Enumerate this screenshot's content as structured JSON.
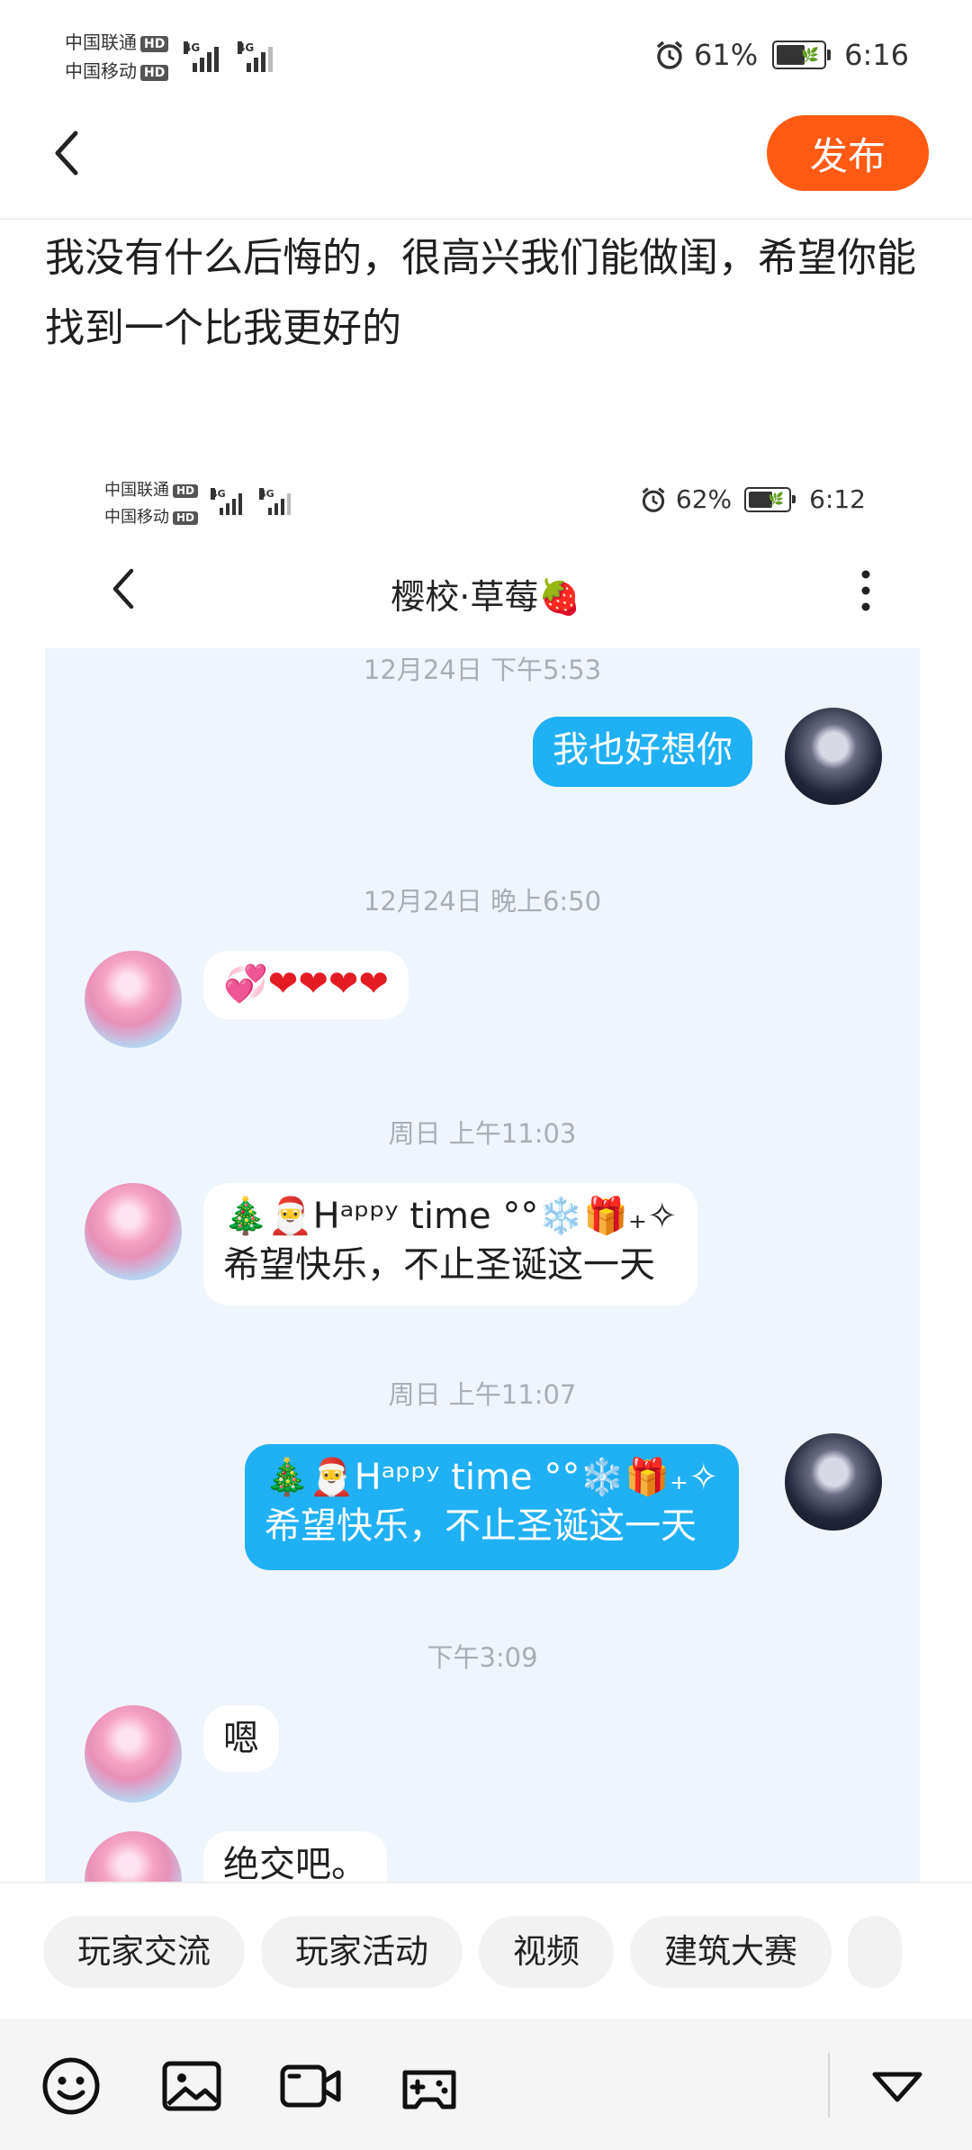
{
  "status_bar": {
    "carrier_1": "中国联通",
    "carrier_2": "中国移动",
    "hd_label": "HD",
    "network": "4G",
    "battery": "61%",
    "battery_level": 0.61,
    "time": "6:16"
  },
  "header": {
    "publish_label": "发布"
  },
  "post": {
    "text": "我没有什么后悔的，很高兴我们能做闺，希望你能找到一个比我更好的"
  },
  "embedded_screenshot": {
    "status_bar": {
      "carrier_1": "中国联通",
      "carrier_2": "中国移动",
      "hd_label": "HD",
      "network": "4G",
      "battery": "62%",
      "battery_level": 0.62,
      "time": "6:12"
    },
    "chat_title": "樱校·草莓🍓",
    "messages": [
      {
        "timestamp": "12月24日 下午5:53"
      },
      {
        "direction": "out",
        "text": "我也好想你"
      },
      {
        "timestamp": "12月24日 晚上6:50"
      },
      {
        "direction": "in",
        "text": "💞❤❤❤❤"
      },
      {
        "timestamp": "周日 上午11:03"
      },
      {
        "direction": "in",
        "line1": "🎄🎅ᕼᵃᵖᵖʸ time °°❄️🎁₊✧",
        "line2": "希望快乐，不止圣诞这一天"
      },
      {
        "timestamp": "周日 上午11:07"
      },
      {
        "direction": "out",
        "line1": "🎄🎅ᕼᵃᵖᵖʸ time °°❄️🎁₊✧",
        "line2": "希望快乐，不止圣诞这一天"
      },
      {
        "timestamp": "下午3:09"
      },
      {
        "direction": "in",
        "text": "嗯"
      },
      {
        "direction": "in",
        "text": "绝交吧。"
      }
    ]
  },
  "topics": [
    "玩家交流",
    "玩家活动",
    "视频",
    "建筑大赛"
  ],
  "toolbar": {
    "icons": [
      "emoji-icon",
      "image-icon",
      "video-icon",
      "gamepad-icon",
      "collapse-icon"
    ]
  }
}
